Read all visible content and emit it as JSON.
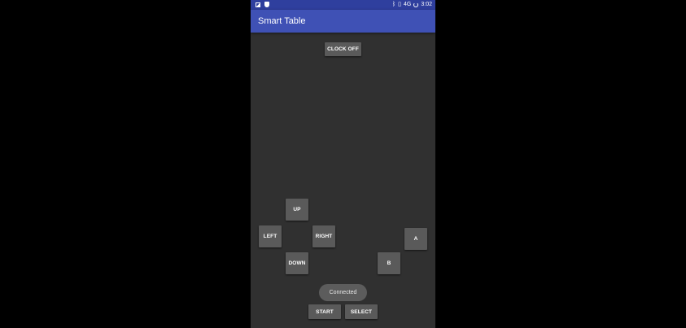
{
  "status_bar": {
    "time": "3:02",
    "network_label": "4G",
    "icons": [
      "image-icon",
      "shield-icon",
      "bluetooth-icon",
      "vibrate-icon",
      "network-icon",
      "sync-icon"
    ]
  },
  "app_bar": {
    "title": "Smart Table",
    "color": "#3f51b5"
  },
  "controls": {
    "clock_label": "CLOCK OFF",
    "dpad": {
      "up": "UP",
      "left": "LEFT",
      "right": "RIGHT",
      "down": "DOWN"
    },
    "action": {
      "a": "A",
      "b": "B"
    },
    "start": "START",
    "select": "SELECT"
  },
  "toast": {
    "text": "Connected"
  },
  "colors": {
    "background": "#303030",
    "button": "#5a5a5a",
    "status_bar": "#2f3f9e"
  }
}
